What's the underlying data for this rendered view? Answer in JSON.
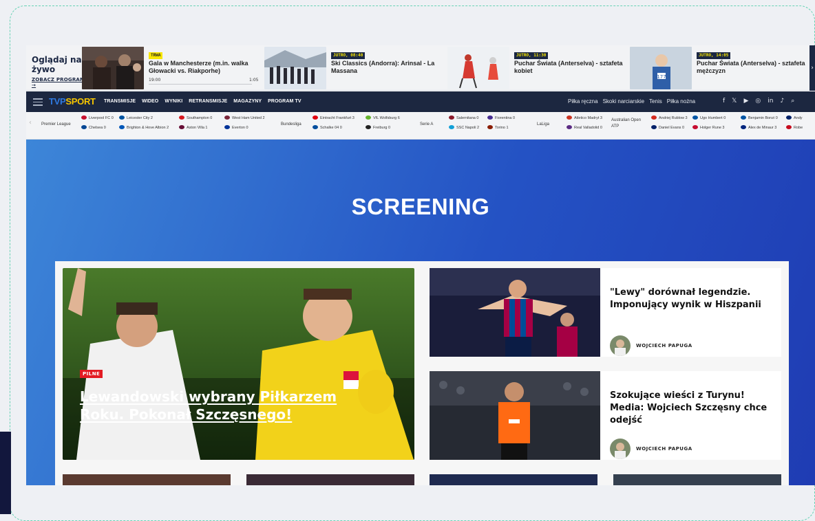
{
  "live": {
    "cta_title": "Oglądaj na żywo",
    "cta_link": "ZOBACZ PROGRAM →",
    "cards": [
      {
        "badge": "TRWA",
        "badge_bg": "#f7e600",
        "badge_fg": "#222",
        "title": "Gala w Manchesterze (m.in. walka Głowacki vs. Riakporhe)",
        "time": "19:00",
        "duration": "1:05"
      },
      {
        "badge": "JUTRO, 08:40",
        "badge_bg": "#1b2743",
        "badge_fg": "#f7e600",
        "title": "Ski Classics (Andorra): Arinsal - La Massana"
      },
      {
        "badge": "JUTRO, 11:30",
        "badge_bg": "#1b2743",
        "badge_fg": "#f7e600",
        "title": "Puchar Świata (Anterselva) - sztafeta kobiet"
      },
      {
        "badge": "JUTRO, 14:05",
        "badge_bg": "#1b2743",
        "badge_fg": "#f7e600",
        "title": "Puchar Świata (Anterselva) - sztafeta mężczyzn"
      }
    ],
    "arrow": "›"
  },
  "nav": {
    "logo_a": "TVP",
    "logo_b": "SPORT",
    "menu": [
      "TRANSMISJE",
      "WIDEO",
      "WYNIKI",
      "RETRANSMISJE",
      "MAGAZYNY",
      "PROGRAM TV"
    ],
    "disciplines": [
      "Piłka ręczna",
      "Skoki narciarskie",
      "Tenis",
      "Piłka nożna"
    ],
    "social": [
      "f",
      "𝕏",
      "▶",
      "◎",
      "in",
      "♪",
      "⌕"
    ]
  },
  "scores": {
    "leagues": [
      "Premier League",
      "Bundesliga",
      "Serie A",
      "LaLiga",
      "Australian Open ATP"
    ],
    "matches": [
      {
        "a": "Liverpool FC",
        "as": "0",
        "b": "Chelsea",
        "bs": "0"
      },
      {
        "a": "Leicester City",
        "as": "2",
        "b": "Brighton & Hove Albion",
        "bs": "2"
      },
      {
        "a": "Southampton",
        "as": "0",
        "b": "Aston Villa",
        "bs": "1"
      },
      {
        "a": "West Ham United",
        "as": "2",
        "b": "Everton",
        "bs": "0"
      },
      {
        "a": "Eintracht Frankfurt",
        "as": "3",
        "b": "Schalke 04",
        "bs": "0"
      },
      {
        "a": "VfL Wolfsburg",
        "as": "6",
        "b": "Freiburg",
        "bs": "0"
      },
      {
        "a": "Salernitana",
        "as": "0",
        "b": "SSC Napoli",
        "bs": "2"
      },
      {
        "a": "Fiorentina",
        "as": "0",
        "b": "Torino",
        "bs": "1"
      },
      {
        "a": "Atletico Madryt",
        "as": "3",
        "b": "Real Valladolid",
        "bs": "0"
      },
      {
        "a": "Andriej Rublow",
        "as": "3",
        "b": "Daniel Evans",
        "bs": "0"
      },
      {
        "a": "Ugo Humbert",
        "as": "0",
        "b": "Holger Rune",
        "bs": "3"
      },
      {
        "a": "Benjamin Bonzi",
        "as": "0",
        "b": "Alex de Minaur",
        "bs": "3"
      },
      {
        "a": "Andy",
        "as": "",
        "b": "Robe",
        "bs": ""
      }
    ]
  },
  "hero": {
    "title": "SCREENING"
  },
  "feature": {
    "badge": "PILNE",
    "headline": "Lewandowski wybrany Piłkarzem Roku. Pokonał Szczęsnego!"
  },
  "stories": [
    {
      "headline": "\"Lewy\" dorównał legendzie. Imponujący wynik w Hiszpanii",
      "author": "WOJCIECH PAPUGA"
    },
    {
      "headline": "Szokujące wieści z Turynu! Media: Wojciech Szczęsny chce odejść",
      "author": "WOJCIECH PAPUGA"
    }
  ],
  "colors": {
    "nav": "#1c2740",
    "accent_blue": "#2e79e0",
    "accent_yellow": "#f7c600",
    "breaking": "#e31b23"
  }
}
